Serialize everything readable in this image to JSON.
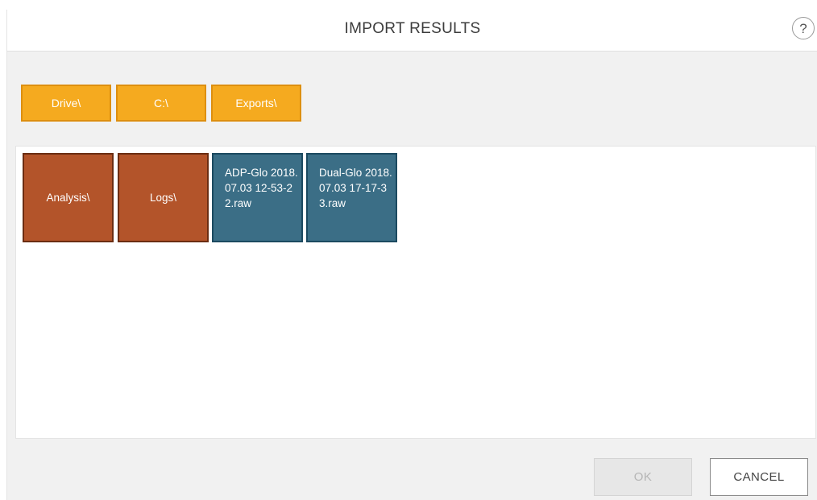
{
  "dialog": {
    "title": "IMPORT RESULTS",
    "help_label": "?"
  },
  "breadcrumbs": [
    {
      "label": "Drive\\"
    },
    {
      "label": "C:\\"
    },
    {
      "label": "Exports\\"
    }
  ],
  "items": {
    "folders": [
      {
        "label": "Analysis\\"
      },
      {
        "label": "Logs\\"
      }
    ],
    "files": [
      {
        "label": "ADP-Glo 2018.07.03 12-53-22.raw"
      },
      {
        "label": "Dual-Glo 2018.07.03 17-17-33.raw"
      }
    ]
  },
  "footer": {
    "ok_label": "OK",
    "ok_state": "disabled",
    "cancel_label": "CANCEL"
  },
  "colors": {
    "breadcrumb": "#f5aa1f",
    "folder_tile": "#b3542a",
    "file_tile": "#3b6e86"
  }
}
